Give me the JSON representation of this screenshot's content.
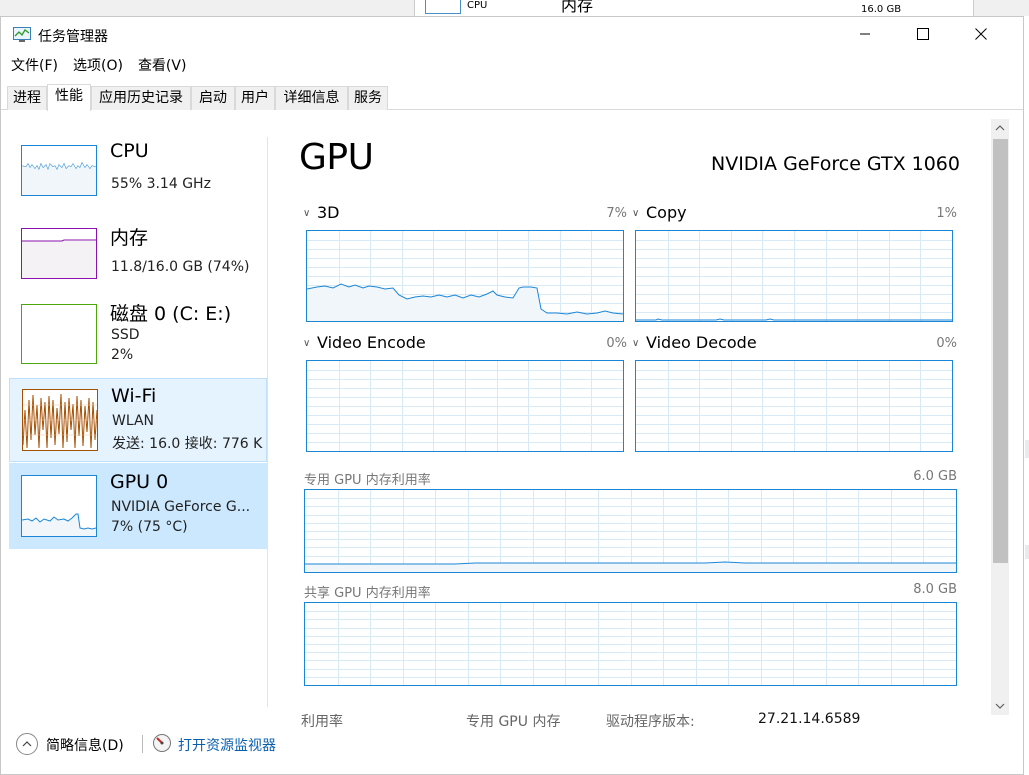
{
  "background": {
    "cpu_label": "CPU",
    "mem_label": "内存",
    "mem_size": "16.0 GB"
  },
  "window": {
    "title": "任务管理器"
  },
  "menu": [
    {
      "label": "文件(F)"
    },
    {
      "label": "选项(O)"
    },
    {
      "label": "查看(V)"
    }
  ],
  "tabs": [
    {
      "label": "进程"
    },
    {
      "label": "性能"
    },
    {
      "label": "应用历史记录"
    },
    {
      "label": "启动"
    },
    {
      "label": "用户"
    },
    {
      "label": "详细信息"
    },
    {
      "label": "服务"
    }
  ],
  "active_tab": "性能",
  "sidebar": {
    "items": [
      {
        "title": "CPU",
        "sub1": "55% 3.14 GHz",
        "sub2": "",
        "sub3": "",
        "color": "#1b86d6"
      },
      {
        "title": "内存",
        "sub1": "11.8/16.0 GB (74%)",
        "sub2": "",
        "sub3": "",
        "color": "#8b12ae"
      },
      {
        "title": "磁盘 0 (C: E:)",
        "sub1": "SSD",
        "sub2": "2%",
        "sub3": "",
        "color": "#4da60c"
      },
      {
        "title": "Wi-Fi",
        "sub1": "WLAN",
        "sub2": "发送: 16.0 接收: 776 K",
        "sub3": "",
        "color": "#a74f01"
      },
      {
        "title": "GPU 0",
        "sub1": "NVIDIA GeForce G...",
        "sub2": "7% (75 °C)",
        "sub3": "",
        "color": "#1b86d6"
      }
    ],
    "selected": "GPU 0"
  },
  "main": {
    "heading": "GPU",
    "model": "NVIDIA GeForce GTX 1060",
    "engines": [
      {
        "name": "3D",
        "percent": "7%"
      },
      {
        "name": "Copy",
        "percent": "1%"
      },
      {
        "name": "Video Encode",
        "percent": "0%"
      },
      {
        "name": "Video Decode",
        "percent": "0%"
      }
    ],
    "dedicated_memory": {
      "label": "专用 GPU 内存利用率",
      "max": "6.0 GB"
    },
    "shared_memory": {
      "label": "共享 GPU 内存利用率",
      "max": "8.0 GB"
    },
    "stats": {
      "utilization_label": "利用率",
      "dedicated_label": "专用 GPU 内存",
      "driver_label": "驱动程序版本:",
      "driver_value": "27.21.14.6589"
    }
  },
  "footer": {
    "fewer_details": "简略信息(D)",
    "open_resmon": "打开资源监视器"
  },
  "colors": {
    "accent_blue": "#1b86d6",
    "selected_bg": "#cce8ff",
    "link": "#0a5fad"
  }
}
